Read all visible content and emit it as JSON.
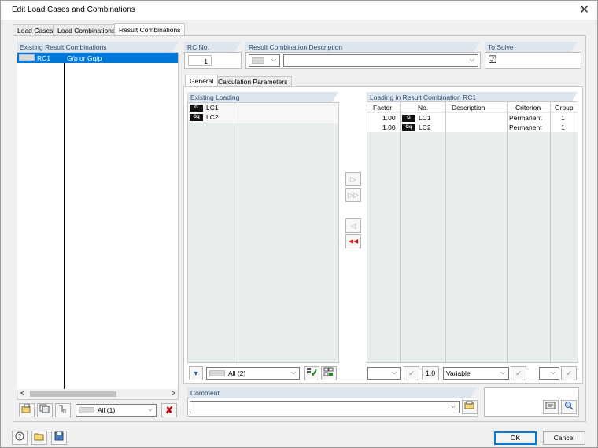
{
  "window": {
    "title": "Edit Load Cases and Combinations"
  },
  "tabs": [
    {
      "label": "Load Cases"
    },
    {
      "label": "Load Combinations"
    },
    {
      "label": "Result Combinations"
    }
  ],
  "left_panel": {
    "header": "Existing Result Combinations",
    "items": [
      {
        "id": "RC1",
        "desc": "G/p or Gq/p"
      }
    ],
    "filter_value": "All (1)"
  },
  "rc_no": {
    "label": "RC No.",
    "value": "1"
  },
  "description": {
    "label": "Result Combination Description",
    "value": ""
  },
  "to_solve": {
    "label": "To Solve",
    "checked": "☑"
  },
  "inner_tabs": [
    {
      "label": "General"
    },
    {
      "label": "Calculation Parameters"
    }
  ],
  "existing_loading": {
    "header": "Existing Loading",
    "items": [
      {
        "tag": "G",
        "name": "LC1"
      },
      {
        "tag": "Gq",
        "name": "LC2"
      }
    ],
    "filter_value": "All (2)"
  },
  "result_loading": {
    "header": "Loading in Result Combination RC1",
    "columns": [
      "Factor",
      "No.",
      "Description",
      "Criterion",
      "Group"
    ],
    "rows": [
      {
        "factor": "1.00",
        "tag": "G",
        "no": "LC1",
        "description": "",
        "criterion": "Permanent",
        "group": "1"
      },
      {
        "factor": "1.00",
        "tag": "Gq",
        "no": "LC2",
        "description": "",
        "criterion": "Permanent",
        "group": "1"
      }
    ],
    "factor_button": "1.0",
    "criterion_value": "Variable"
  },
  "comment": {
    "label": "Comment",
    "value": ""
  },
  "buttons": {
    "ok": "OK",
    "cancel": "Cancel"
  },
  "icons": {
    "close": "✕",
    "chevron": "⌵",
    "delete": "✘",
    "check": "✔",
    "filter": "▼",
    "arrow_right": "▷",
    "arrow_right_all": "▷▷",
    "arrow_left": "◁",
    "arrow_left_all": "◀◀",
    "scroll_left": "<",
    "scroll_right": ">"
  },
  "colors": {
    "selection": "#0078d7",
    "header_bg": "#dde6ef",
    "header_text": "#2f4e6e",
    "delete_red": "#c00000"
  }
}
